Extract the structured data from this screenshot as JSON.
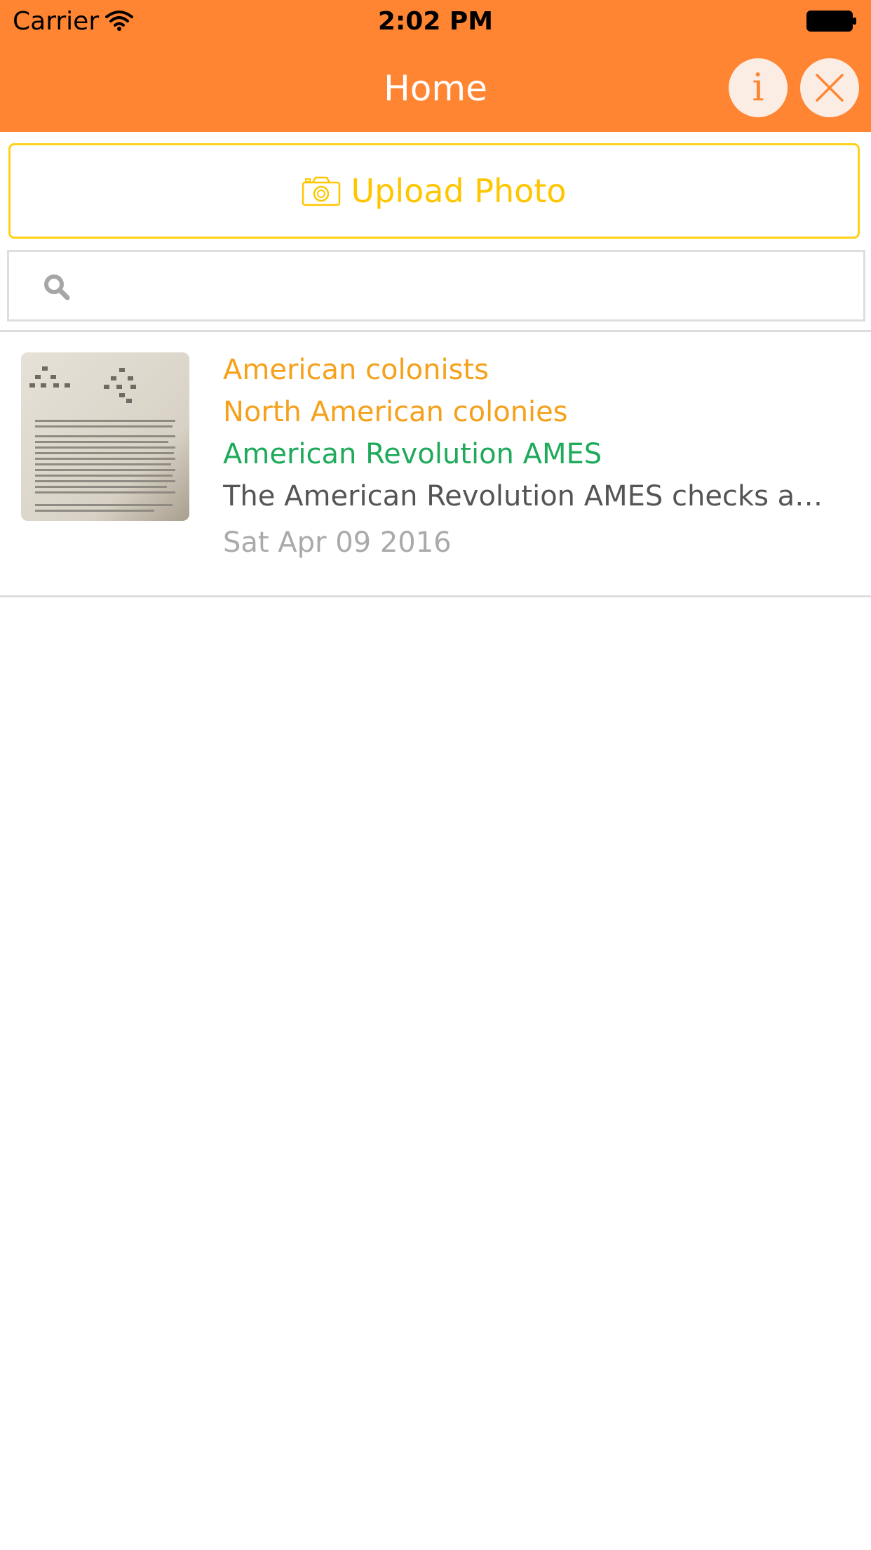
{
  "status_bar": {
    "carrier": "Carrier",
    "time": "2:02 PM"
  },
  "nav": {
    "title": "Home",
    "info_glyph": "i"
  },
  "upload": {
    "label": "Upload Photo"
  },
  "search": {
    "value": "",
    "placeholder": ""
  },
  "items": [
    {
      "tag1": "American colonists",
      "tag2": "North American colonies",
      "tag3": "American Revolution AMES",
      "snippet": "The American Revolution AMES checks and…",
      "date": "Sat Apr 09 2016"
    }
  ],
  "colors": {
    "nav_bar": "#ff8533",
    "upload_accent": "#ffc600",
    "tag_orange": "#f5a11b",
    "tag_green": "#1faa5b"
  },
  "icons": {
    "wifi": "wifi-icon",
    "battery": "battery-icon",
    "info": "info-icon",
    "close": "close-icon",
    "camera": "camera-icon",
    "search": "search-icon"
  }
}
